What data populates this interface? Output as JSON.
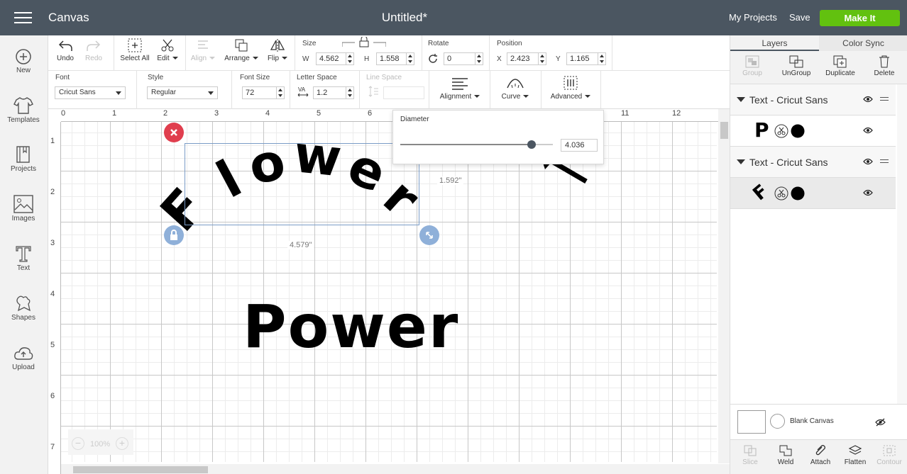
{
  "header": {
    "app_title": "Canvas",
    "doc_title": "Untitled*",
    "my_projects": "My Projects",
    "save": "Save",
    "make_it": "Make It"
  },
  "leftbar": {
    "items": [
      {
        "label": "New",
        "icon": "plus-circle-icon"
      },
      {
        "label": "Templates",
        "icon": "tshirt-icon"
      },
      {
        "label": "Projects",
        "icon": "book-icon"
      },
      {
        "label": "Images",
        "icon": "image-icon"
      },
      {
        "label": "Text",
        "icon": "text-icon"
      },
      {
        "label": "Shapes",
        "icon": "shapes-icon"
      },
      {
        "label": "Upload",
        "icon": "cloud-upload-icon"
      }
    ]
  },
  "toolbar": {
    "undo": "Undo",
    "redo": "Redo",
    "select_all": "Select All",
    "edit": "Edit",
    "align": "Align",
    "arrange": "Arrange",
    "flip": "Flip",
    "size_label": "Size",
    "w_label": "W",
    "w_value": "4.562",
    "h_label": "H",
    "h_value": "1.558",
    "rotate_label": "Rotate",
    "rotate_value": "0",
    "position_label": "Position",
    "x_label": "X",
    "x_value": "2.423",
    "y_label": "Y",
    "y_value": "1.165"
  },
  "text_toolbar": {
    "font_label": "Font",
    "font_value": "Cricut Sans",
    "style_label": "Style",
    "style_value": "Regular",
    "font_size_label": "Font Size",
    "font_size_value": "72",
    "letter_space_label": "Letter Space",
    "letter_space_value": "1.2",
    "line_space_label": "Line Space",
    "alignment": "Alignment",
    "curve": "Curve",
    "advanced": "Advanced"
  },
  "ruler": {
    "top": [
      "0",
      "1",
      "2",
      "3",
      "4",
      "5",
      "6",
      "7",
      "8",
      "9",
      "10",
      "11",
      "12",
      "1"
    ],
    "left": [
      "1",
      "2",
      "3",
      "4",
      "5",
      "6",
      "7"
    ]
  },
  "canvas": {
    "curved_text": "Flower",
    "power_text": "Power",
    "height_label": "1.592\"",
    "width_label": "4.579\"",
    "zoom": "100%"
  },
  "diameter_popup": {
    "label": "Diameter",
    "value": "4.036",
    "slider_fraction": 0.86
  },
  "rightpanel": {
    "tabs": [
      "Layers",
      "Color Sync"
    ],
    "actions": [
      "Group",
      "UnGroup",
      "Duplicate",
      "Delete"
    ],
    "layer_groups": [
      {
        "title": "Text - Cricut Sans",
        "glyph": "P"
      },
      {
        "title": "Text - Cricut Sans",
        "glyph": "F"
      }
    ],
    "blank_canvas": "Blank Canvas",
    "bottom_actions": [
      "Slice",
      "Weld",
      "Attach",
      "Flatten",
      "Contour"
    ]
  },
  "colors": {
    "topbar": "#4b5661",
    "make_it": "#62c10f",
    "close_handle": "#e03e4e",
    "handle_blue": "#8fb0d9"
  }
}
